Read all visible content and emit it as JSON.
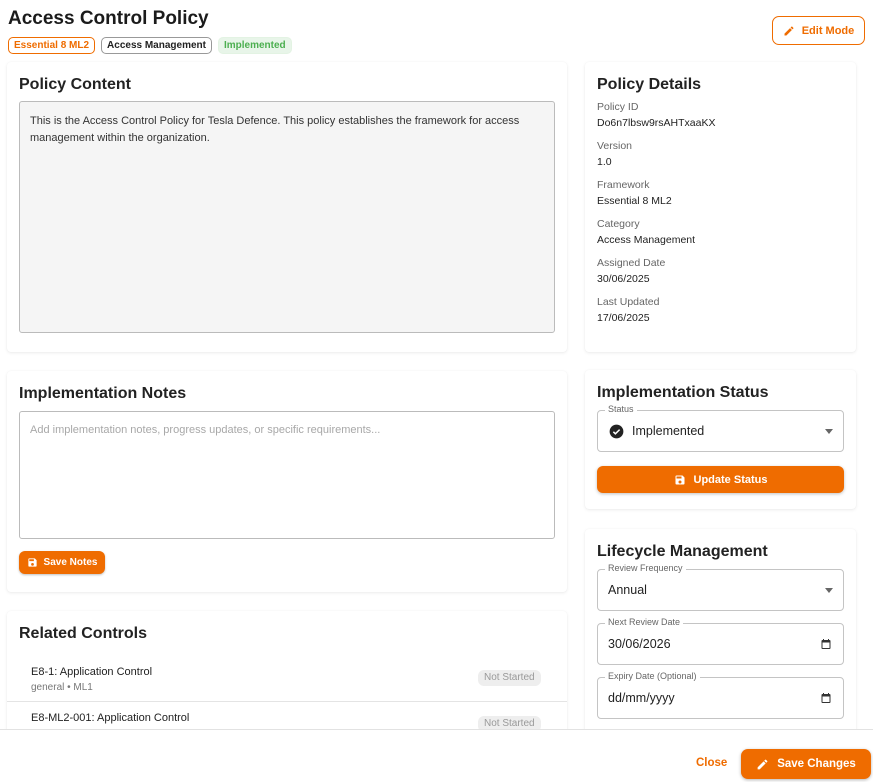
{
  "header": {
    "title": "Access Control Policy",
    "chips": [
      "Essential 8 ML2",
      "Access Management",
      "Implemented"
    ],
    "edit_mode_label": "Edit Mode"
  },
  "policy_content": {
    "title": "Policy Content",
    "text": "This is the Access Control Policy for Tesla Defence. This policy establishes the framework for access management within the organization."
  },
  "policy_details": {
    "title": "Policy Details",
    "items": [
      {
        "label": "Policy ID",
        "value": "Do6n7lbsw9rsAHTxaaKX"
      },
      {
        "label": "Version",
        "value": "1.0"
      },
      {
        "label": "Framework",
        "value": "Essential 8 ML2"
      },
      {
        "label": "Category",
        "value": "Access Management"
      },
      {
        "label": "Assigned Date",
        "value": "30/06/2025"
      },
      {
        "label": "Last Updated",
        "value": "17/06/2025"
      }
    ]
  },
  "implementation_notes": {
    "title": "Implementation Notes",
    "placeholder": "Add implementation notes, progress updates, or specific requirements...",
    "save_label": "Save Notes"
  },
  "related_controls": {
    "title": "Related Controls",
    "items": [
      {
        "name": "E8-1: Application Control",
        "meta": "general • ML1",
        "status": "Not Started"
      },
      {
        "name": "E8-ML2-001: Application Control",
        "meta": "",
        "status": "Not Started"
      }
    ]
  },
  "implementation_status": {
    "title": "Implementation Status",
    "field_label": "Status",
    "value": "Implemented",
    "update_label": "Update Status"
  },
  "lifecycle": {
    "title": "Lifecycle Management",
    "review_frequency_label": "Review Frequency",
    "review_frequency_value": "Annual",
    "next_review_label": "Next Review Date",
    "next_review_value": "30/06/2026",
    "expiry_label": "Expiry Date (Optional)",
    "expiry_value": "dd/mm/yyyy"
  },
  "footer": {
    "close_label": "Close",
    "save_label": "Save Changes"
  },
  "colors": {
    "accent": "#ef6c00",
    "success": "#4caf50"
  }
}
